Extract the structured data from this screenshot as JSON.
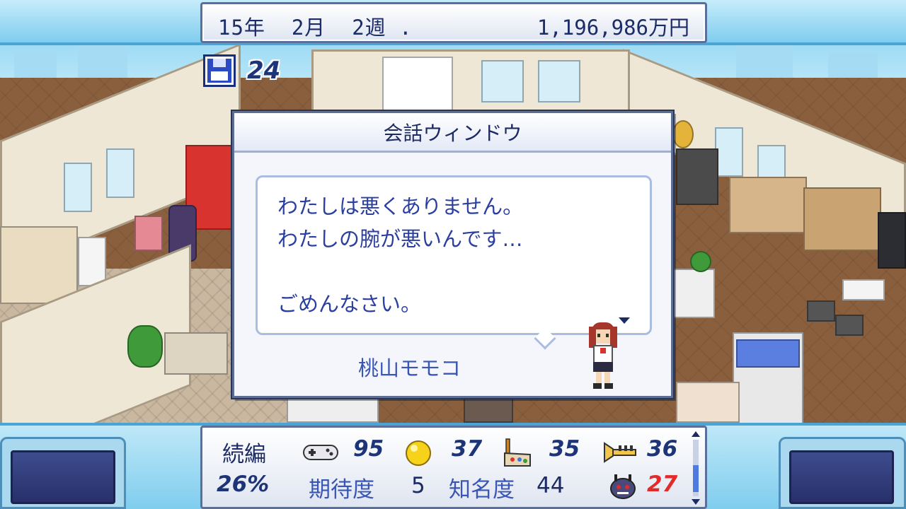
{
  "status_bar": {
    "date": "15年  2月  2週 .",
    "funds": "1,196,986万円"
  },
  "save": {
    "icon": "floppy-disk-icon",
    "count": "24"
  },
  "dialog": {
    "title": "会話ウィンドウ",
    "message_lines": [
      "わたしは悪くありません。",
      "わたしの腕が悪いんです…",
      "",
      "ごめんなさい。"
    ],
    "speaker": "桃山モモコ"
  },
  "project_stats": {
    "genre_label": "続編",
    "progress": "26%",
    "fun_icon": "gamepad-icon",
    "fun": "95",
    "creativity_icon": "lightbulb-icon",
    "creativity": "37",
    "graphics_icon": "paint-palette-icon",
    "graphics": "35",
    "sound_icon": "trumpet-icon",
    "sound": "36",
    "expectation_label": "期待度",
    "expectation": "5",
    "fame_label": "知名度",
    "fame": "44",
    "bugs_icon": "bug-monster-icon",
    "bugs": "27"
  },
  "colors": {
    "accent_blue": "#2a3fa0",
    "bug_red": "#e22a2a",
    "frame_blue": "#4aa5d4"
  }
}
